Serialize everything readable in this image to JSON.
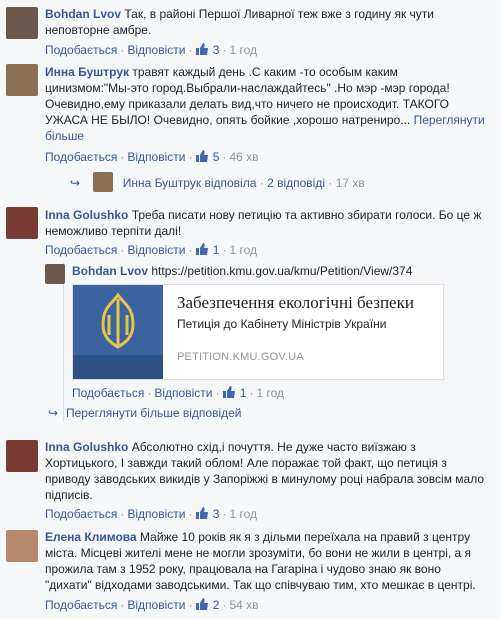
{
  "common": {
    "like": "Подобається",
    "reply": "Відповісти",
    "dot": "·"
  },
  "comments": [
    {
      "name": "Bohdan Lvov",
      "text": "Так, в районі Першої Ливарної теж вже з годину як чути неповторне амбре.",
      "likes": "3",
      "time": "1 год"
    },
    {
      "name": "Инна Буштрук",
      "text": "травят каждый день .С каким -то особым каким цинизмом:\"Мы-это город.Выбрали-наслаждайтесь\" .Но мэр -мэр города! Очевидно,ему приказали делать вид,что ничего не происходит. ТАКОГО УЖАСА НЕ БЫЛО! Очевидно, опять бойкие ,хорошо натрениро...",
      "more": "Переглянути більше",
      "likes": "5",
      "time": "46 хв"
    },
    {
      "name": "Inna Golushko",
      "text": "Треба писати нову петицію та активно збирати голоси. Бо це ж неможливо терпіти далі!",
      "likes": "1",
      "time": "1 год"
    },
    {
      "name": "Bohdan Lvov",
      "text": "https://petition.kmu.gov.ua/kmu/Petition/View/374",
      "likes": "1",
      "time": "1 год"
    },
    {
      "name": "Inna Golushko",
      "text": "Абсолютно схід,і почуття. Не дуже часто виїзжаю з Хортицького, І завжди такий облом! Але поражає той факт, що петиція з приводу заводських викидів у Запоріжжі в минулому році набрала зовсім мало підписів.",
      "likes": "3",
      "time": "1 год"
    },
    {
      "name": "Елена Климова",
      "text": "Майже 10 років як я з дільми переїхала на правий з центру міста. Місцеві жителі мене не могли зрозуміти, бо вони не жили в центрі, а я прожила там з 1952 року, працювала на Гагаріна і чудово знаю як воно \"дихати\" відходами заводськими. Так що співчуваю тим, хто мешкає в центрі.",
      "likes": "2",
      "time": "54 хв"
    }
  ],
  "reply_summary": {
    "name": "Инна Буштрук",
    "action": "відповіла",
    "count": "2 відповіді",
    "time": "17 хв"
  },
  "preview": {
    "title": "Забезпечення екологічні безпеки",
    "subtitle": "Петиція до Кабінету Міністрів України",
    "domain": "PETITION.KMU.GOV.UA"
  },
  "more_replies": "Переглянути більше відповідей"
}
